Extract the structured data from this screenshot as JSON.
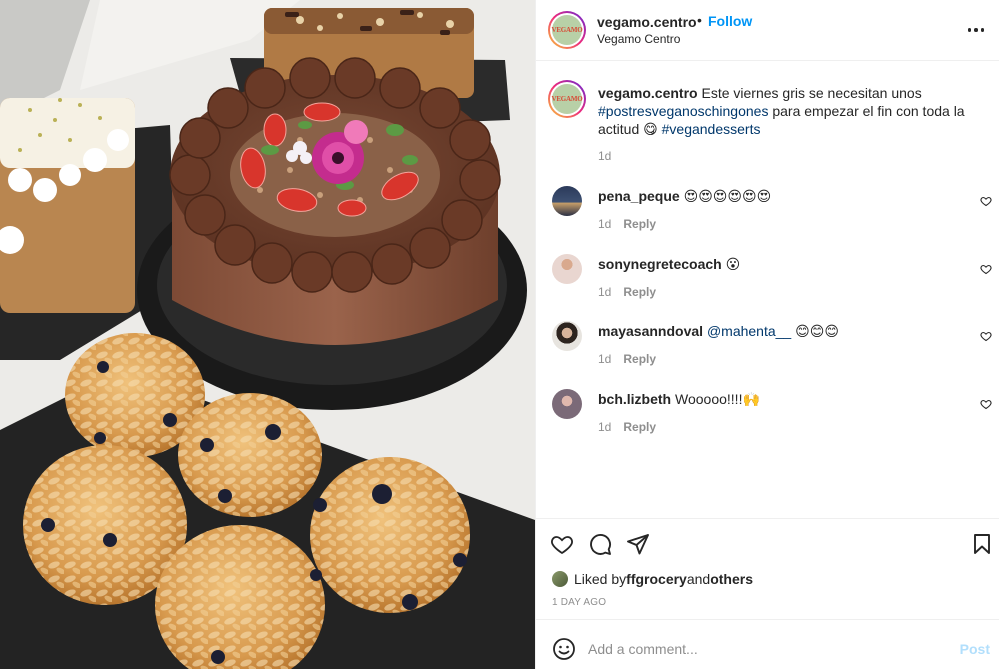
{
  "post": {
    "username": "vegamo.centro",
    "follow_label": "Follow",
    "separator": "•",
    "location": "Vegamo Centro",
    "logo_text": "VEGAMO",
    "image_alt": "Vegan desserts: chocolate cake with strawberries and flowers, almond muffins and loaf cakes"
  },
  "caption": {
    "username": "vegamo.centro",
    "text_1": " Este viernes gris se necesitan unos ",
    "hashtag_1": "#postresveganoschingones",
    "text_2": " para empezar el fin con toda la actitud 😋 ",
    "hashtag_2": "#vegandesserts",
    "time": "1d"
  },
  "comments": [
    {
      "username": "pena_peque",
      "mention": "",
      "text": " 😍😍😍😍😍😍",
      "time": "1d",
      "reply": "Reply"
    },
    {
      "username": "sonynegretecoach",
      "mention": "",
      "text": " 😮",
      "time": "1d",
      "reply": "Reply"
    },
    {
      "username": "mayasanndoval",
      "mention": "@mahenta__",
      "text": " 😊😊😊",
      "time": "1d",
      "reply": "Reply"
    },
    {
      "username": "bch.lizbeth",
      "mention": "",
      "text": " Wooooo!!!!🙌",
      "time": "1d",
      "reply": "Reply"
    }
  ],
  "likes": {
    "prefix": "Liked by ",
    "user": "ffgrocery",
    "middle": " and ",
    "others": "others"
  },
  "date": "1 DAY AGO",
  "add_comment": {
    "placeholder": "Add a comment...",
    "post_label": "Post"
  },
  "icons": {
    "more": "more-horizontal-icon",
    "like": "heart-icon",
    "comment": "comment-bubble-icon",
    "share": "paper-plane-icon",
    "save": "bookmark-icon",
    "emoji": "emoji-smile-icon"
  },
  "colors": {
    "link_blue": "#0095f6",
    "hashtag": "#00376b",
    "muted": "#8e8e8e",
    "post_disabled": "#b2dffc"
  }
}
